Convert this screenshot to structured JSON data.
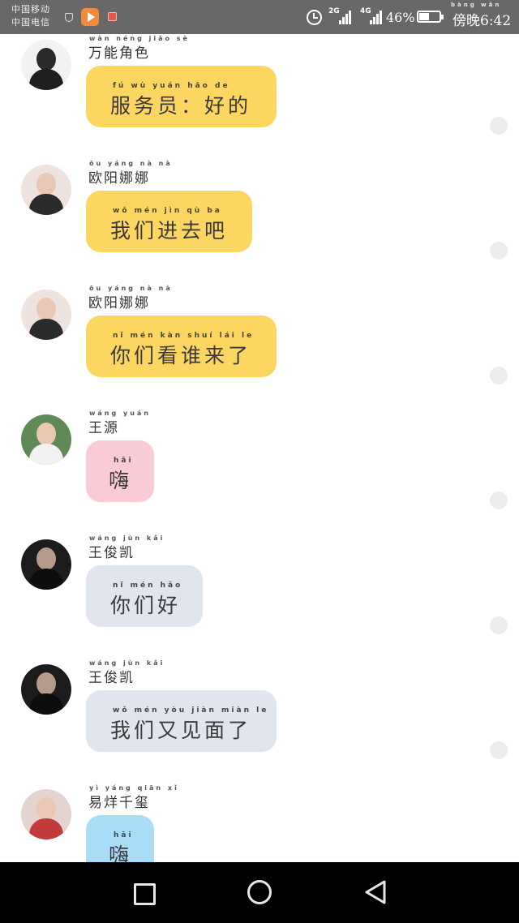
{
  "status_bar": {
    "carrier_1": "中国移动",
    "carrier_2": "中国电信",
    "net_1": "2G",
    "net_2": "4G",
    "battery": "46%",
    "time": "傍晚6:42",
    "time_pinyin": "bàng wǎn"
  },
  "messages": [
    {
      "name": "万能角色",
      "name_pinyin": "wàn néng jiǎo sè",
      "text": "服务员：好的",
      "text_pinyin": "fú wù yuán   hǎo de",
      "bubble_color": "#fbd660",
      "avatar_color": "#2a2a2a"
    },
    {
      "name": "欧阳娜娜",
      "name_pinyin": "ōu yáng nà nà",
      "text": "我们进去吧",
      "text_pinyin": "wǒ mén jìn qù ba",
      "bubble_color": "#fbd660",
      "avatar_color": "#d9c2bb"
    },
    {
      "name": "欧阳娜娜",
      "name_pinyin": "ōu yáng nà nà",
      "text": "你们看谁来了",
      "text_pinyin": "nǐ mén kàn shuí lái le",
      "bubble_color": "#fbd660",
      "avatar_color": "#d9c2bb"
    },
    {
      "name": "王源",
      "name_pinyin": "wáng yuán",
      "text": "嗨",
      "text_pinyin": "hāi",
      "bubble_color": "#f9cbd6",
      "avatar_color": "#4f7f4a"
    },
    {
      "name": "王俊凯",
      "name_pinyin": "wáng jùn kǎi",
      "text": "你们好",
      "text_pinyin": "nǐ mén hǎo",
      "bubble_color": "#e0e5ee",
      "avatar_color": "#1c1c1c"
    },
    {
      "name": "王俊凯",
      "name_pinyin": "wáng jùn kǎi",
      "text": "我们又见面了",
      "text_pinyin": "wǒ mén yòu jiàn miàn le",
      "bubble_color": "#e0e5ee",
      "avatar_color": "#1c1c1c"
    },
    {
      "name": "易烊千玺",
      "name_pinyin": "yì yáng qiān xǐ",
      "text": "嗨",
      "text_pinyin": "hāi",
      "bubble_color": "#a9ddf7",
      "avatar_color": "#c23a3a"
    }
  ]
}
